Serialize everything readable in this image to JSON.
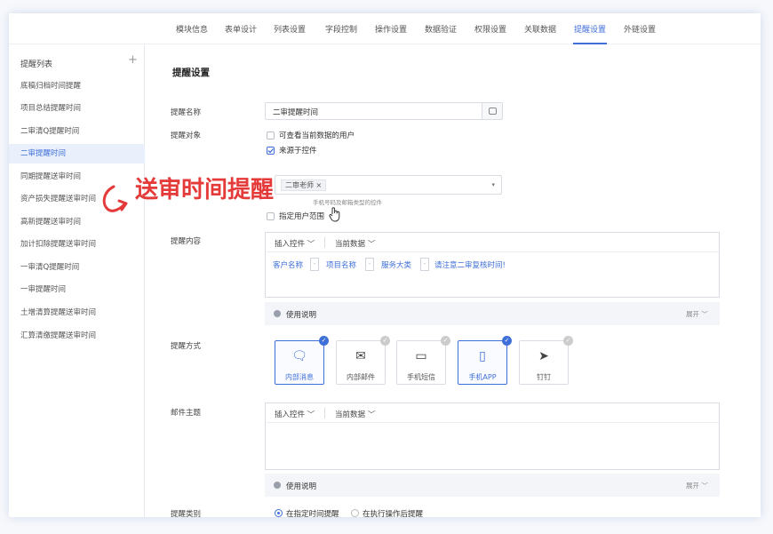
{
  "top_tabs": [
    "模块信息",
    "表单设计",
    "列表设置",
    "字段控制",
    "操作设置",
    "数据验证",
    "权限设置",
    "关联数据",
    "提醒设置",
    "外链设置"
  ],
  "active_tab": "提醒设置",
  "sidebar": {
    "title": "提醒列表",
    "add_icon": "+",
    "items": [
      "底稿归档时间提醒",
      "项目总结提醒时间",
      "二审清Q提醒时间",
      "二审提醒时间",
      "同期提醒送审时间",
      "资产损失提醒送审时间",
      "高新提醒送审时间",
      "加计扣除提醒送审时间",
      "一审清Q提醒时间",
      "一审提醒时间",
      "土增清算提醒送审时间",
      "汇算清缴提醒送审时间"
    ],
    "active": "二审提醒时间"
  },
  "main": {
    "title": "提醒设置",
    "name_label": "提醒名称",
    "name_value": "二审提醒时间",
    "target_label": "提醒对象",
    "opt_viewers": "可查看当前数据的用户",
    "opt_from_control": "来源于控件",
    "selected_tag": "二审老师",
    "tag_remove": "×",
    "hint": "手机号码及邮箱类型的控件",
    "opt_specified_users": "指定用户范围",
    "content_label": "提醒内容",
    "insert_control": "插入控件",
    "current_data": "当前数据",
    "content_fields": [
      "客户名称",
      "项目名称",
      "服务大类"
    ],
    "content_note": "请注意二审复核时间!",
    "usage": "使用说明",
    "expand": "展开",
    "method_label": "提醒方式",
    "methods": [
      {
        "label": "内部消息",
        "icon": "chat-icon",
        "selected": true
      },
      {
        "label": "内部邮件",
        "icon": "mail-icon",
        "selected": false
      },
      {
        "label": "手机短信",
        "icon": "sms-icon",
        "selected": false
      },
      {
        "label": "手机APP",
        "icon": "phone-icon",
        "selected": true
      },
      {
        "label": "钉钉",
        "icon": "dingtalk-icon",
        "selected": false
      }
    ],
    "mail_subject_label": "邮件主题",
    "category_label": "提醒类别",
    "radio_timed": "在指定时间提醒",
    "radio_after_op": "在执行操作后提醒"
  },
  "annotation": "送审时间提醒",
  "colors": {
    "accent": "#3f6fd8",
    "annotation": "#e53a3a",
    "note": "#c98542"
  }
}
